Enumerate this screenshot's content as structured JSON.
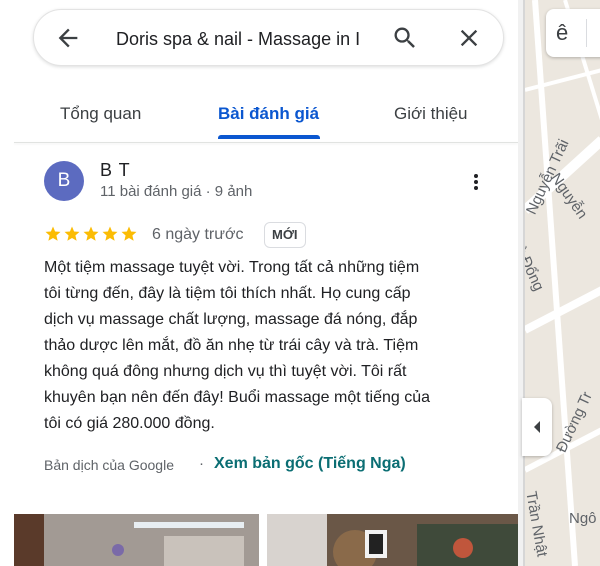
{
  "search": {
    "query": "Doris spa & nail - Massage in I"
  },
  "tabs": [
    {
      "label": "Tổng quan"
    },
    {
      "label": "Bài đánh giá"
    },
    {
      "label": "Giới thiệu"
    }
  ],
  "active_tab": "Bài đánh giá",
  "review": {
    "avatar_letter": "B",
    "reviewer_name": "B T",
    "reviewer_meta": "11 bài đánh giá · 9 ảnh",
    "rating": 5,
    "date": "6 ngày trước",
    "badge": "MỚI",
    "text_lines": [
      "Một tiệm massage tuyệt vời. Trong tất cả những tiệm",
      "tôi từng đến, đây là tiệm tôi thích nhất. Họ cung cấp",
      "dịch vụ massage chất lượng, massage đá nóng, đắp",
      "thảo dược lên mắt, đồ ăn nhẹ từ trái cây và trà. Tiệm",
      "không quá đông nhưng dịch vụ thì tuyệt vời. Tôi rất",
      "khuyên bạn nên đến đây! Buổi massage một tiếng của",
      "tôi có giá 280.000 đồng."
    ],
    "translation_label": "Bản dịch của Google",
    "translation_separator": "·",
    "view_original_label": "Xem bản gốc (Tiếng Nga)"
  },
  "map": {
    "button_label": "ê",
    "streets": [
      "Nguyễn Trãi",
      "Nguyễn",
      "Phù Đổng",
      "Đường Tr",
      "Trần Nhật",
      "Ngô"
    ]
  },
  "colors": {
    "accent": "#0b57d0",
    "star": "#fbbc04",
    "avatar": "#5c6bc0",
    "link": "#0b6e73"
  }
}
